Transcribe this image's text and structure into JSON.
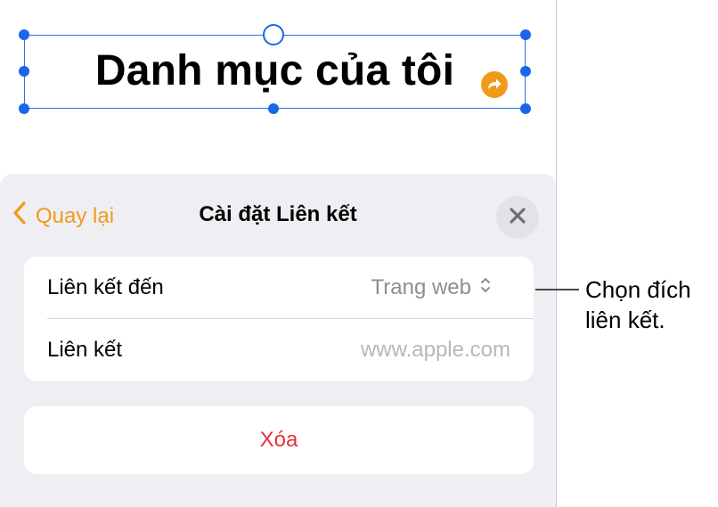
{
  "canvas": {
    "heading": "Danh mục của tôi"
  },
  "link_settings": {
    "back_label": "Quay lại",
    "title": "Cài đặt Liên kết",
    "rows": [
      {
        "label": "Liên kết đến",
        "value": "Trang web"
      },
      {
        "label": "Liên kết",
        "placeholder": "www.apple.com"
      }
    ],
    "delete_label": "Xóa"
  },
  "callout": {
    "line1": "Chọn đích",
    "line2": "liên kết."
  },
  "colors": {
    "accent": "#f09a1a",
    "selection": "#1a66e8",
    "destructive": "#e8303a"
  },
  "icons": {
    "back": "chevron-left-icon",
    "close": "close-icon",
    "link_badge": "link-arrow-icon",
    "value_picker": "chevron-up-down-icon"
  }
}
